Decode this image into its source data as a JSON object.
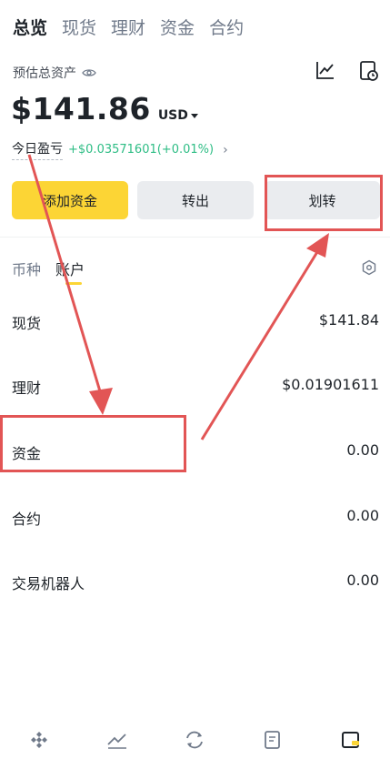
{
  "top_tabs": [
    {
      "label": "总览",
      "active": true
    },
    {
      "label": "现货",
      "active": false
    },
    {
      "label": "理财",
      "active": false
    },
    {
      "label": "资金",
      "active": false
    },
    {
      "label": "合约",
      "active": false
    }
  ],
  "summary": {
    "est_label": "预估总资产",
    "amount": "$141.86",
    "currency": "USD",
    "pnl_label": "今日盈亏",
    "pnl_value": "+$0.03571601(+0.01%)"
  },
  "actions": {
    "deposit": "添加资金",
    "withdraw": "转出",
    "transfer": "划转"
  },
  "sub_tabs": [
    {
      "label": "币种",
      "active": false
    },
    {
      "label": "账户",
      "active": true
    }
  ],
  "accounts": [
    {
      "name": "现货",
      "value": "$141.84"
    },
    {
      "name": "理财",
      "value": "$0.01901611"
    },
    {
      "name": "资金",
      "value": "0.00"
    },
    {
      "name": "合约",
      "value": "0.00"
    },
    {
      "name": "交易机器人",
      "value": "0.00"
    }
  ],
  "colors": {
    "accent_yellow": "#fcd535",
    "profit_green": "#2ebd85",
    "annotation_red": "#e25555"
  },
  "icons": {
    "bottom_nav": [
      "home-icon",
      "markets-icon",
      "trade-icon",
      "orders-icon",
      "wallet-icon"
    ]
  }
}
